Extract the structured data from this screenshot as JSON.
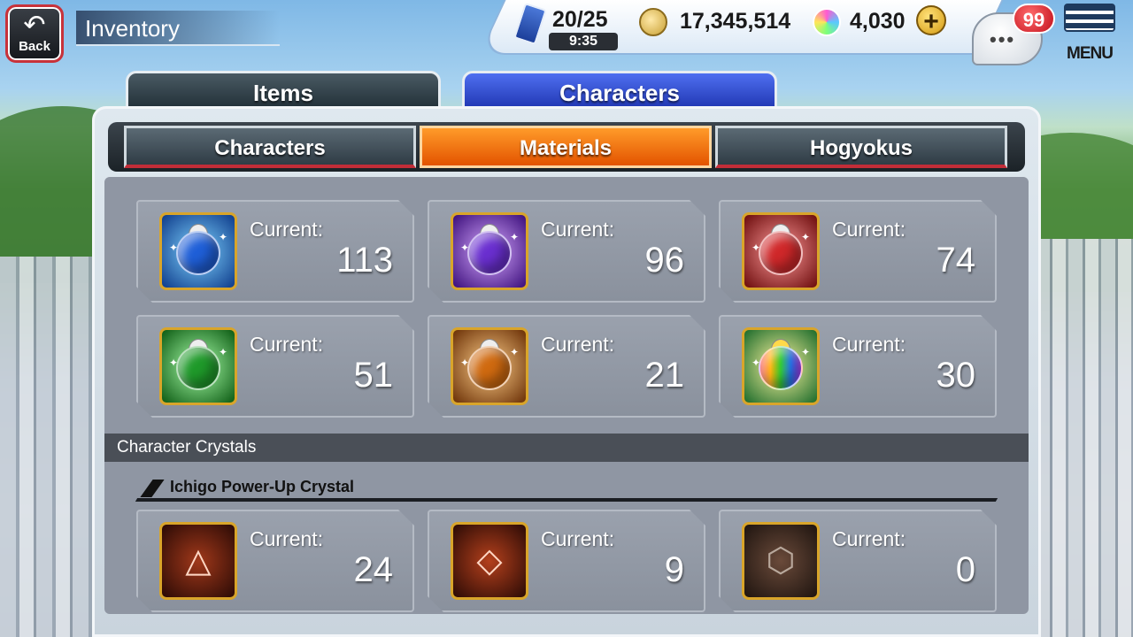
{
  "header": {
    "back_label": "Back",
    "title": "Inventory"
  },
  "status": {
    "stamina": "20/25",
    "stamina_timer": "9:35",
    "coins": "17,345,514",
    "orbs": "4,030",
    "notifications": "99",
    "menu_label": "MENU"
  },
  "main_tabs": [
    {
      "label": "Items",
      "active": false
    },
    {
      "label": "Characters",
      "active": true
    }
  ],
  "sub_tabs": [
    {
      "label": "Characters",
      "active": false
    },
    {
      "label": "Materials",
      "active": true
    },
    {
      "label": "Hogyokus",
      "active": false
    }
  ],
  "materials": [
    {
      "current_label": "Current:",
      "value": "113",
      "color": "#1f5fd8",
      "icon": "blue-potion-icon"
    },
    {
      "current_label": "Current:",
      "value": "96",
      "color": "#6a2fd0",
      "icon": "purple-potion-icon"
    },
    {
      "current_label": "Current:",
      "value": "74",
      "color": "#d0282a",
      "icon": "red-potion-icon"
    },
    {
      "current_label": "Current:",
      "value": "51",
      "color": "#1f9a2a",
      "icon": "green-potion-icon"
    },
    {
      "current_label": "Current:",
      "value": "21",
      "color": "#d06a10",
      "icon": "orange-potion-icon"
    },
    {
      "current_label": "Current:",
      "value": "30",
      "color": "rainbow",
      "icon": "rainbow-potion-icon"
    }
  ],
  "crystals": {
    "section_title": "Character Crystals",
    "group_title": "Ichigo Power-Up Crystal",
    "items": [
      {
        "current_label": "Current:",
        "value": "24",
        "icon": "triangle-skull-crystal-icon"
      },
      {
        "current_label": "Current:",
        "value": "9",
        "icon": "square-skull-crystal-icon"
      },
      {
        "current_label": "Current:",
        "value": "0",
        "icon": "hexagon-skull-crystal-icon"
      }
    ]
  }
}
